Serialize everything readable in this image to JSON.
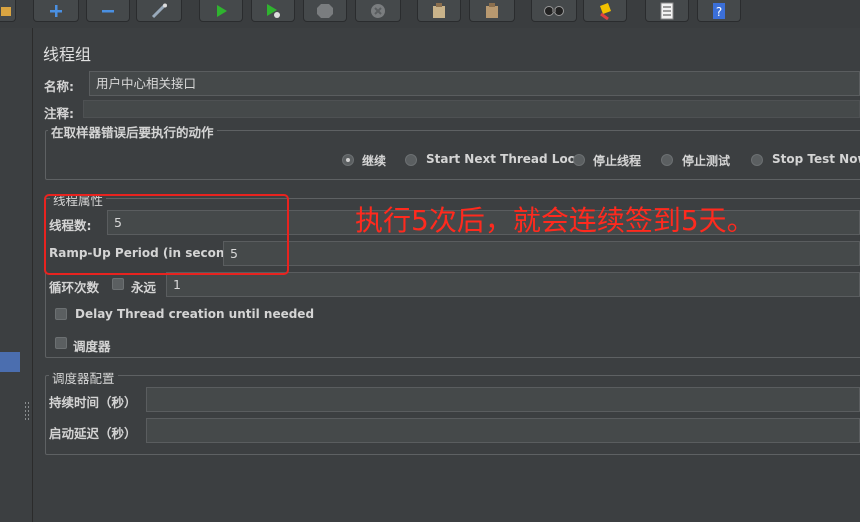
{
  "toolbar": {
    "icons": [
      "folder-icon",
      "plus-icon",
      "minus-icon",
      "wand-icon",
      "start-icon",
      "start-no-pause-icon",
      "stop-icon",
      "shutdown-icon",
      "clear-icon",
      "clear-all-icon",
      "search-icon",
      "reset-search-icon",
      "function-helper-icon",
      "help-icon"
    ]
  },
  "panel": {
    "title": "线程组",
    "name_label": "名称:",
    "name_value": "用户中心相关接口",
    "comment_label": "注释:",
    "comment_value": ""
  },
  "error_action": {
    "group_title": "在取样器错误后要执行的动作",
    "options": [
      "继续",
      "Start Next Thread Loop",
      "停止线程",
      "停止测试",
      "Stop Test Now"
    ],
    "selected": "继续"
  },
  "thread_props": {
    "group_title": "线程属性",
    "threads_label": "线程数:",
    "threads_value": "5",
    "rampup_label": "Ramp-Up Period (in seconds):",
    "rampup_value": "5",
    "loop_label": "循环次数",
    "forever_label": "永远",
    "loop_value": "1",
    "delay_label": "Delay Thread creation until needed",
    "scheduler_label": "调度器"
  },
  "scheduler": {
    "group_title": "调度器配置",
    "duration_label": "持续时间（秒）",
    "duration_value": "",
    "startup_delay_label": "启动延迟（秒）",
    "startup_delay_value": ""
  },
  "annotation": {
    "text": "执行5次后，就会连续签到5天。",
    "color": "#ff2a1e"
  },
  "colors": {
    "background": "#3c3f41",
    "selection": "#4b6eaf",
    "annotation_box": "#e8231f"
  }
}
